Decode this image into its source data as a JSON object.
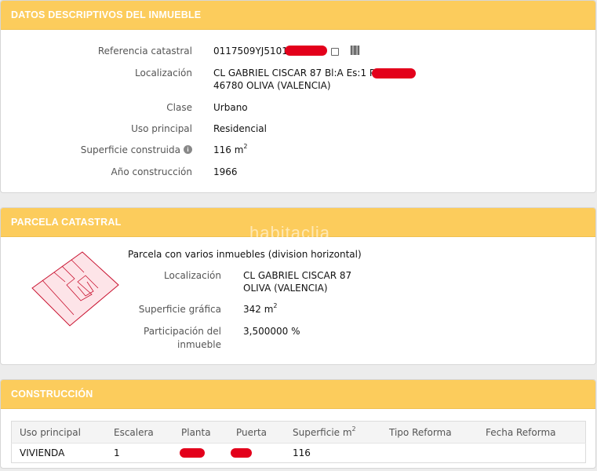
{
  "datos": {
    "header": "DATOS DESCRIPTIVOS DEL INMUEBLE",
    "referencia_label": "Referencia catastral",
    "referencia_value": "0117509YJ5101",
    "localizacion_label": "Localización",
    "localizacion_line1": "CL GABRIEL CISCAR 87 Bl:A Es:1 Pl",
    "localizacion_line2": "46780 OLIVA (VALENCIA)",
    "clase_label": "Clase",
    "clase_value": "Urbano",
    "uso_label": "Uso principal",
    "uso_value": "Residencial",
    "superficie_label": "Superficie construida",
    "superficie_value": "116 m",
    "superficie_unit_sup": "2",
    "info_icon_glyph": "i",
    "anio_label": "Año construcción",
    "anio_value": "1966"
  },
  "parcela": {
    "header": "PARCELA CATASTRAL",
    "watermark": "habitaclia",
    "title": "Parcela con varios inmuebles (division horizontal)",
    "localizacion_label": "Localización",
    "localizacion_line1": "CL GABRIEL CISCAR 87",
    "localizacion_line2": "OLIVA (VALENCIA)",
    "superficie_label": "Superficie gráfica",
    "superficie_value": "342 m",
    "superficie_unit_sup": "2",
    "participacion_label_1": "Participación del",
    "participacion_label_2": "inmueble",
    "participacion_value": "3,500000 %"
  },
  "construccion": {
    "header": "CONSTRUCCIÓN",
    "columns": [
      "Uso principal",
      "Escalera",
      "Planta",
      "Puerta",
      "Superficie m",
      "Tipo Reforma",
      "Fecha Reforma"
    ],
    "superficie_col_sup": "2",
    "rows": [
      {
        "uso": "VIVIENDA",
        "escalera": "1",
        "planta": "",
        "puerta": "",
        "superficie": "116",
        "tipo_reforma": "",
        "fecha_reforma": ""
      }
    ]
  },
  "colors": {
    "header_bg": "#fccc5c",
    "redaction": "#e3001b",
    "parcel_outline": "#c8102e",
    "parcel_fill": "#fde4e8"
  }
}
